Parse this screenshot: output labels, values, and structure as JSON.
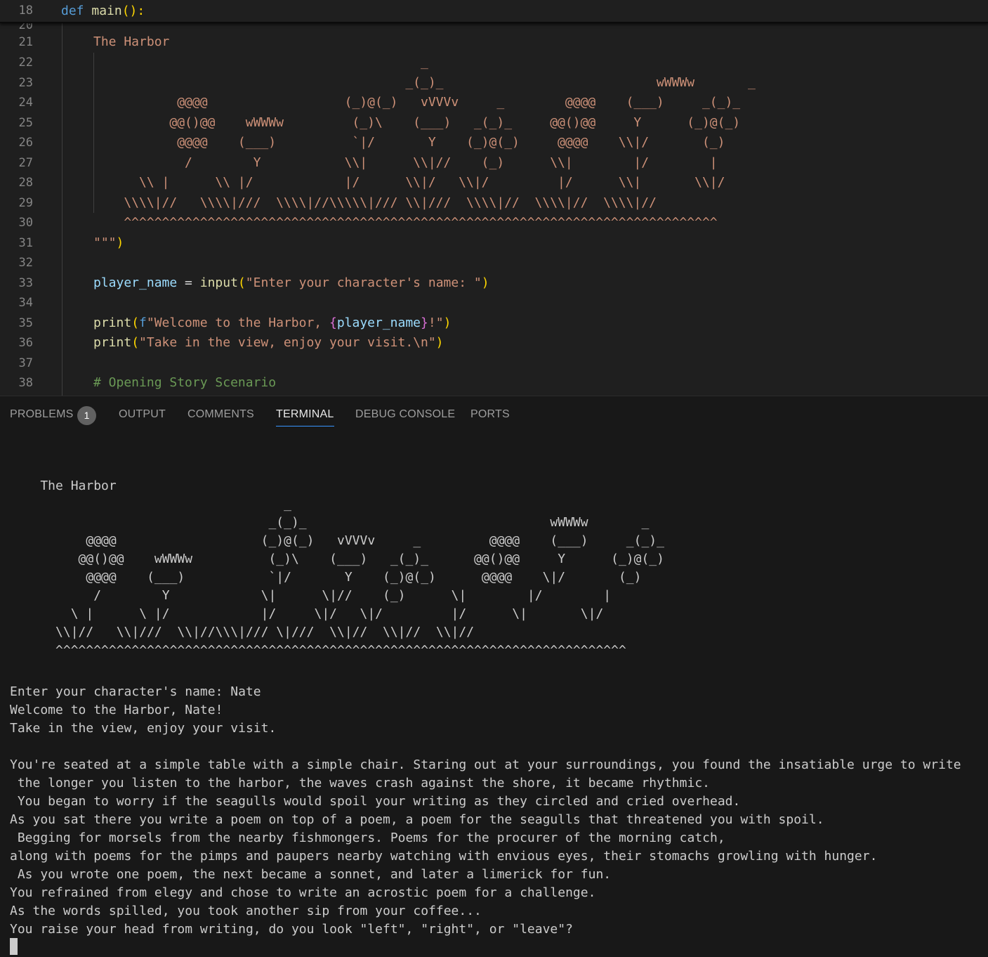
{
  "editor": {
    "sticky": {
      "line_number": "18",
      "keyword": "def",
      "function_name": "main",
      "suffix": "():"
    },
    "partial_line_number": "20",
    "art_heading": "The Harbor",
    "art_lines": [
      {
        "n": "22",
        "text": "                                           _                                             "
      },
      {
        "n": "23",
        "text": "                                         _(_)_                            wWWWw       _   "
      },
      {
        "n": "24",
        "text": "           @@@@                  (_)@(_)   vVVVv     _        @@@@    (___)     _(_)_ "
      },
      {
        "n": "25",
        "text": "          @@()@@    wWWWw         (_)\\    (___)   _(_)_     @@()@@     Y      (_)@(_)"
      },
      {
        "n": "26",
        "text": "           @@@@    (___)          `|/       Y    (_)@(_)     @@@@    \\\\|/       (_)"
      },
      {
        "n": "27",
        "text": "            /        Y           \\\\|      \\\\|//    (_)      \\\\|        |/        |"
      },
      {
        "n": "28",
        "text": "      \\\\ |      \\\\ |/            |/      \\\\|/   \\\\|/         |/      \\\\|       \\\\|/"
      },
      {
        "n": "29",
        "text": "    \\\\\\\\|//   \\\\\\\\|///  \\\\\\\\|//\\\\\\\\\\|/// \\\\|///  \\\\\\\\|//  \\\\\\\\|//  \\\\\\\\|//"
      },
      {
        "n": "30",
        "text": "    ^^^^^^^^^^^^^^^^^^^^^^^^^^^^^^^^^^^^^^^^^^^^^^^^^^^^^^^^^^^^^^^^^^^^^^^^^^^^^^"
      }
    ],
    "lines": {
      "n21": "21",
      "n31": "31",
      "n32": "32",
      "n33": "33",
      "n34": "34",
      "n35": "35",
      "n36": "36",
      "n37": "37",
      "n38": "38",
      "close_quotes": "\"\"\"",
      "close_paren": ")",
      "player_var": "player_name",
      "assign": " = ",
      "input_fn": "input",
      "input_str": "\"Enter your character's name: \"",
      "print_fn": "print",
      "f_prefix": "f",
      "welcome_str_a": "\"Welcome to the Harbor, ",
      "open_brace": "{",
      "player_ref": "player_name",
      "close_brace": "}",
      "welcome_str_b": "!\"",
      "take_str": "\"Take in the view, enjoy your visit.\\n\"",
      "comment": "# Opening Story Scenario"
    }
  },
  "panel": {
    "tabs": [
      {
        "label": "PROBLEMS",
        "badge": "1"
      },
      {
        "label": "OUTPUT"
      },
      {
        "label": "COMMENTS"
      },
      {
        "label": "TERMINAL",
        "active": true
      },
      {
        "label": "DEBUG CONSOLE"
      },
      {
        "label": "PORTS"
      }
    ]
  },
  "terminal": {
    "art": "    The Harbor\n                                    _\n                                  _(_)_                                wWWWw       _\n          @@@@                   (_)@(_)   vVVVv     _         @@@@    (___)     _(_)_\n         @@()@@    wWWWw          (_)\\    (___)   _(_)_      @@()@@     Y      (_)@(_)\n          @@@@    (___)           `|/       Y    (_)@(_)      @@@@    \\|/       (_)\n           /        Y            \\|      \\|//    (_)      \\|        |/        |\n        \\ |      \\ |/            |/     \\|/   \\|/         |/      \\|       \\|/\n      \\\\|//   \\\\|///  \\\\|//\\\\\\|/// \\|///  \\\\|//  \\\\|//  \\\\|//\n      ^^^^^^^^^^^^^^^^^^^^^^^^^^^^^^^^^^^^^^^^^^^^^^^^^^^^^^^^^^^^^^^^^^^^^^^^^^^",
    "output": "Enter your character's name: Nate\nWelcome to the Harbor, Nate!\nTake in the view, enjoy your visit.\n\nYou're seated at a simple table with a simple chair. Staring out at your surroundings, you found the insatiable urge to write\n the longer you listen to the harbor, the waves crash against the shore, it became rhythmic.\n You began to worry if the seagulls would spoil your writing as they circled and cried overhead.\nAs you sat there you write a poem on top of a poem, a poem for the seagulls that threatened you with spoil.\n Begging for morsels from the nearby fishmongers. Poems for the procurer of the morning catch,\nalong with poems for the pimps and paupers nearby watching with envious eyes, their stomachs growling with hunger.\n As you wrote one poem, the next became a sonnet, and later a limerick for fun.\nYou refrained from elegy and chose to write an acrostic poem for a challenge.\nAs the words spilled, you took another sip from your coffee...\nYou raise your head from writing, do you look \"left\", \"right\", or \"leave\"?"
  }
}
